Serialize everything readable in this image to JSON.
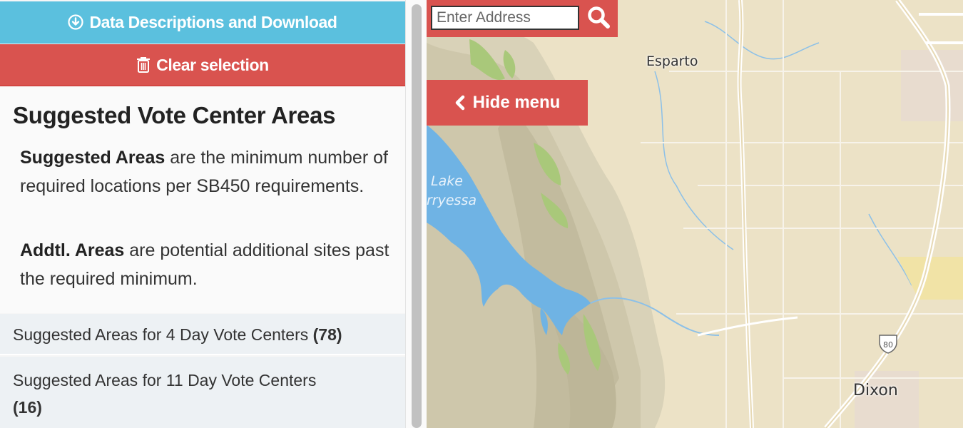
{
  "sidebar": {
    "download_button": "Data Descriptions and Download",
    "clear_button": "Clear selection",
    "title": "Suggested Vote Center Areas",
    "p1_bold": "Suggested Areas",
    "p1_text": " are the minimum number of required locations per SB450 requirements.",
    "p2_bold": "Addtl. Areas",
    "p2_text": " are potential additional sites past the required minimum.",
    "list": [
      {
        "label": "Suggested Areas for 4 Day Vote Centers ",
        "count": "(78)"
      },
      {
        "label": "Suggested Areas for 11 Day Vote Centers",
        "count": "(16)"
      }
    ]
  },
  "map": {
    "search_placeholder": "Enter Address",
    "hide_menu_label": "Hide menu",
    "places": {
      "esparto": "Esparto",
      "dixon": "Dixon"
    },
    "lake_label_1": "Lake",
    "lake_label_2": "rryessa",
    "highway_shield": "80"
  },
  "colors": {
    "info": "#5bc0de",
    "danger": "#d9534f",
    "land": "#ece2c6",
    "water": "#6fb3e4",
    "mountain_shade": "#c9c3aa",
    "forest": "#a9c87a"
  },
  "icons": {
    "download": "download-circle-icon",
    "clear": "trash-icon",
    "search": "search-icon",
    "hide": "chevron-left-icon"
  }
}
